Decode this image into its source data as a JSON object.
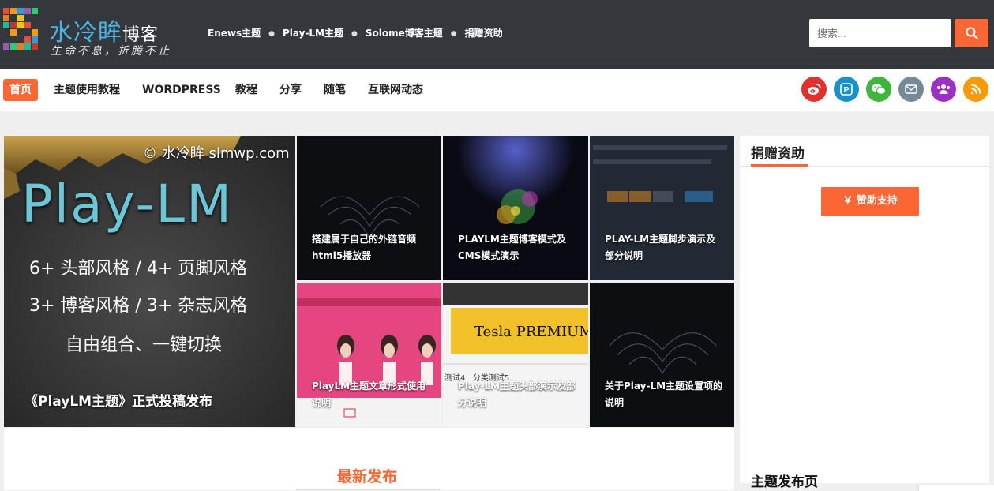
{
  "header": {
    "logo_name": "水冷眸",
    "logo_suffix": "博客",
    "slogan": "生命不息，折腾不止",
    "top_links": [
      "Enews主题",
      "Play-LM主题",
      "Solome博客主题",
      "捐赠资助"
    ],
    "search_placeholder": "搜索...",
    "search_icon": "search-icon",
    "colors": {
      "accent": "#fa6634",
      "topbar_bg": "#34373c",
      "logo_blue": "#4bb3e8"
    }
  },
  "nav": {
    "items": [
      "首页",
      "主题使用教程",
      "WORDPRESS",
      "教程",
      "分享",
      "随笔",
      "互联网动态"
    ],
    "active": "首页",
    "social": [
      {
        "icon": "weibo-icon",
        "color": "#e2312d"
      },
      {
        "icon": "p-icon",
        "color": "#1b8fc7"
      },
      {
        "icon": "wechat-icon",
        "color": "#3eb53b"
      },
      {
        "icon": "mail-icon",
        "color": "#778897"
      },
      {
        "icon": "group-icon",
        "color": "#9c30c5"
      },
      {
        "icon": "rss-icon",
        "color": "#f79a08"
      }
    ]
  },
  "featured": {
    "main": {
      "watermark": "© 水冷眸 slmwp.com",
      "brand": "Play-LM",
      "line1": "6+ 头部风格 / 4+ 页脚风格",
      "line2": "3+ 博客风格 / 3+ 杂志风格",
      "line3": "自由组合、一键切换",
      "caption": "《PlayLM主题》正式投稿发布"
    },
    "grid": [
      {
        "caption": "搭建属于自己的外链音频html5播放器"
      },
      {
        "caption": "PLAYLM主题博客模式及CMS模式演示"
      },
      {
        "caption": "PLAY-LM主题脚步演示及部分说明"
      },
      {
        "caption": "PlayLM主题文章形式使用说明"
      },
      {
        "caption": "Play-LM主题头部演示及部分说明",
        "image_text": "Tesla PREMIUM",
        "image_subtext": "测试4   分类测试5"
      },
      {
        "caption": "关于Play-LM主题设置项的说明"
      }
    ]
  },
  "sidebar": {
    "title": "捐赠资助",
    "donate_label": "￥ 赞助支持",
    "next_title": "主题发布页"
  },
  "latest": {
    "title": "最新发布"
  }
}
